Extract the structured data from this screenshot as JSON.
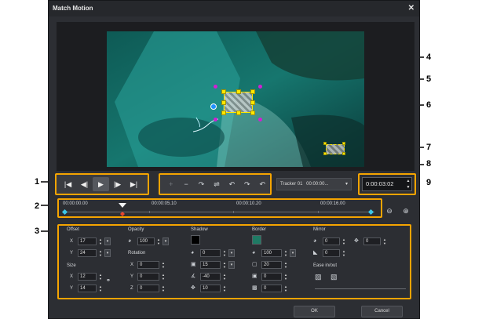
{
  "dialog": {
    "title": "Match Motion",
    "close_label": "✕"
  },
  "playback": {
    "buttons": [
      "|◀",
      "◀|",
      "▶",
      "|▶",
      "▶|"
    ]
  },
  "tracker_tools": {
    "buttons": [
      "+",
      "−",
      "↷",
      "⇌",
      "↶",
      "↷",
      "↶"
    ]
  },
  "tracker_select": {
    "name": "Tracker 01",
    "time": "00:00:00...",
    "arrow": "▾"
  },
  "timecode": {
    "value": "0:00:03:02"
  },
  "timeline": {
    "labels": [
      "00:00:00.00",
      "00:00:05.10",
      "00:00:10.20",
      "00:00:16.00"
    ]
  },
  "offset": {
    "title": "Offset",
    "x_label": "X",
    "x_value": "17",
    "y_label": "Y",
    "y_value": "24"
  },
  "size": {
    "title": "Size",
    "x_label": "X",
    "x_value": "12",
    "y_label": "Y",
    "y_value": "14"
  },
  "opacity": {
    "title": "Opacity",
    "value": "100"
  },
  "rotation": {
    "title": "Rotation",
    "x_label": "X",
    "x_value": "0",
    "y_label": "Y",
    "y_value": "0",
    "z_label": "Z",
    "z_value": "0"
  },
  "shadow": {
    "title": "Shadow",
    "color": "#000000",
    "value1": "0",
    "value2": "15",
    "value3": "-40",
    "value4": "10"
  },
  "border": {
    "title": "Border",
    "color": "#1f7a64",
    "value1": "100",
    "value2": "20",
    "value3": "0",
    "value4": "0"
  },
  "mirror": {
    "title": "Mirror",
    "value1": "0",
    "value2": "0",
    "value3": "0"
  },
  "ease": {
    "title": "Ease in/out"
  },
  "footer": {
    "ok": "OK",
    "cancel": "Cancel"
  },
  "callouts": {
    "c1": "1",
    "c2": "2",
    "c3": "3",
    "c4": "4",
    "c5": "5",
    "c6": "6",
    "c7": "7",
    "c8": "8",
    "c9": "9"
  },
  "colors": {
    "accent": "#f5a400",
    "tracker": "#ffe800",
    "path_point": "#d11fd4"
  }
}
